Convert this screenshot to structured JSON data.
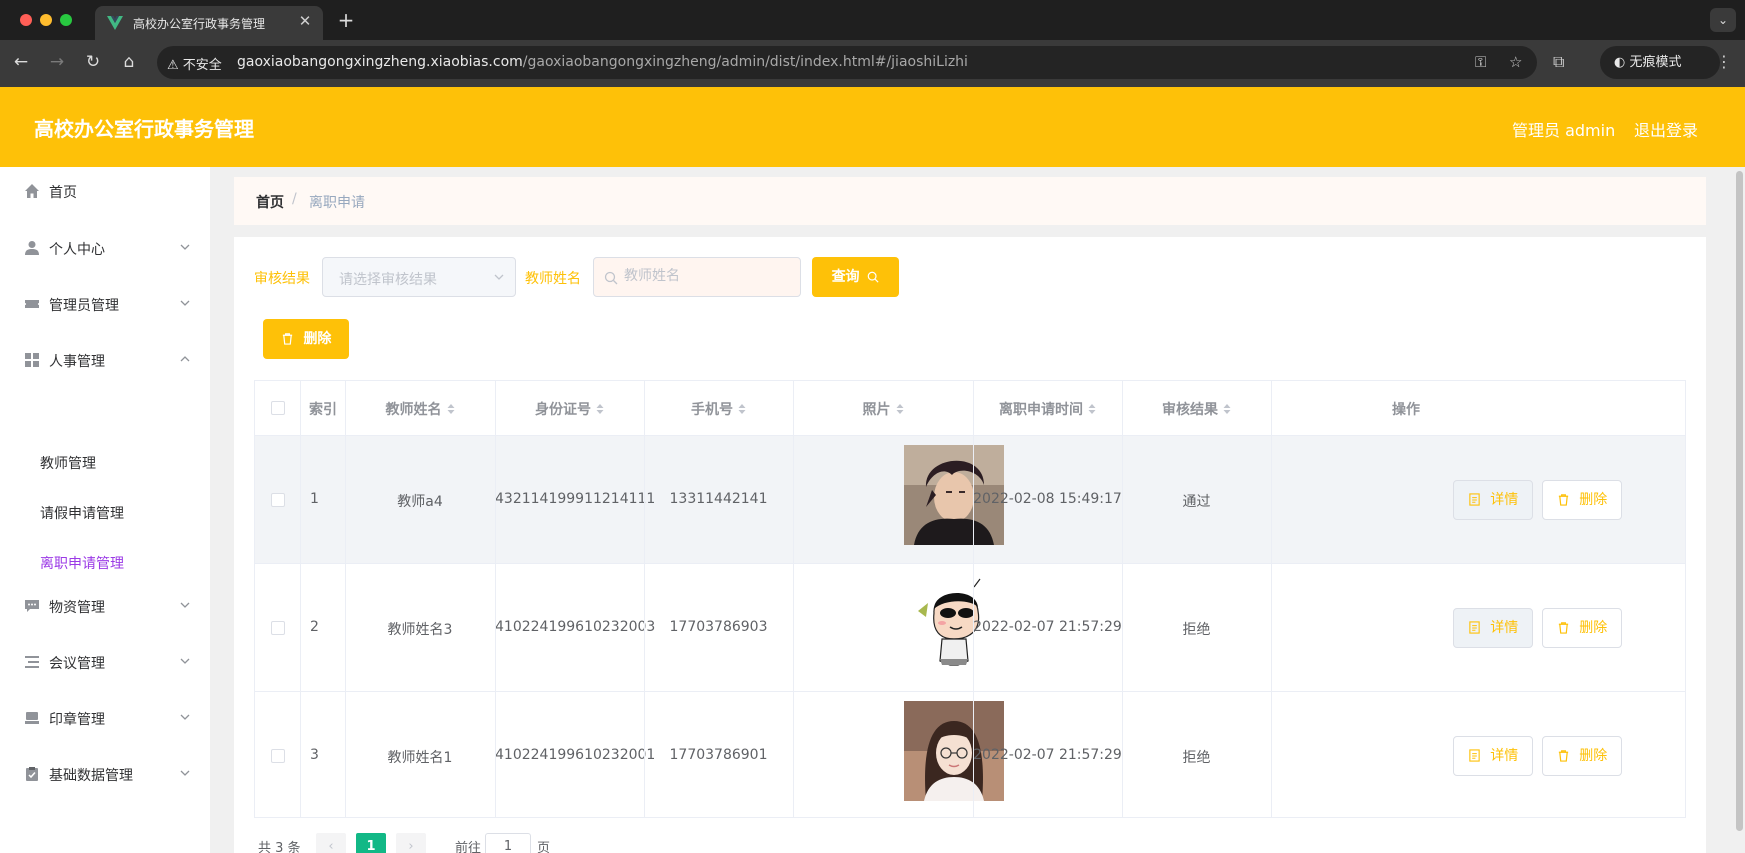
{
  "browser": {
    "tab_title": "高校办公室行政事务管理",
    "insecure_label": "不安全",
    "url_host": "gaoxiaobangongxingzheng.xiaobias.com",
    "url_path": "/gaoxiaobangongxingzheng/admin/dist/index.html#/jiaoshiLizhi",
    "incognito_label": "无痕模式"
  },
  "header": {
    "title": "高校办公室行政事务管理",
    "admin_label": "管理员 admin",
    "logout_label": "退出登录",
    "accent_color": "#fec108"
  },
  "sidebar": {
    "items": [
      {
        "label": "首页",
        "icon": "home-icon"
      },
      {
        "label": "个人中心",
        "icon": "user-icon"
      },
      {
        "label": "管理员管理",
        "icon": "ticket-icon"
      },
      {
        "label": "人事管理",
        "icon": "grid-icon"
      },
      {
        "label": "物资管理",
        "icon": "chat-icon"
      },
      {
        "label": "会议管理",
        "icon": "list-icon"
      },
      {
        "label": "印章管理",
        "icon": "stamp-icon"
      },
      {
        "label": "基础数据管理",
        "icon": "clipboard-icon"
      }
    ],
    "sub_items": [
      {
        "label": "教师管理"
      },
      {
        "label": "请假申请管理"
      },
      {
        "label": "离职申请管理",
        "active": true
      }
    ],
    "active_color": "#9b39e6"
  },
  "breadcrumb": {
    "home": "首页",
    "separator": "/",
    "current": "离职申请"
  },
  "filters": {
    "review_label": "审核结果",
    "review_placeholder": "请选择审核结果",
    "teacher_label": "教师姓名",
    "teacher_placeholder": "教师姓名",
    "query_label": "查询"
  },
  "actions": {
    "delete_label": "删除"
  },
  "table": {
    "headers": {
      "index": "索引",
      "name": "教师姓名",
      "id_card": "身份证号",
      "phone": "手机号",
      "photo": "照片",
      "time": "离职申请时间",
      "result": "审核结果",
      "ops": "操作"
    },
    "detail_label": "详情",
    "delete_label": "删除",
    "rows": [
      {
        "index": "1",
        "name": "教师a4",
        "id_card": "432114199911214111",
        "phone": "13311442141",
        "time": "2022-02-08 15:49:17",
        "result": "通过",
        "photo": "man-photo"
      },
      {
        "index": "2",
        "name": "教师姓名3",
        "id_card": "410224199610232003",
        "phone": "17703786903",
        "time": "2022-02-07 21:57:29",
        "result": "拒绝",
        "photo": "cartoon-photo"
      },
      {
        "index": "3",
        "name": "教师姓名1",
        "id_card": "410224199610232001",
        "phone": "17703786901",
        "time": "2022-02-07 21:57:29",
        "result": "拒绝",
        "photo": "woman-photo"
      }
    ]
  },
  "pagination": {
    "total": "共 3 条",
    "prev": "‹",
    "current_page": "1",
    "next": "›",
    "goto_label": "前往",
    "goto_value": "1",
    "goto_suffix": "页"
  }
}
